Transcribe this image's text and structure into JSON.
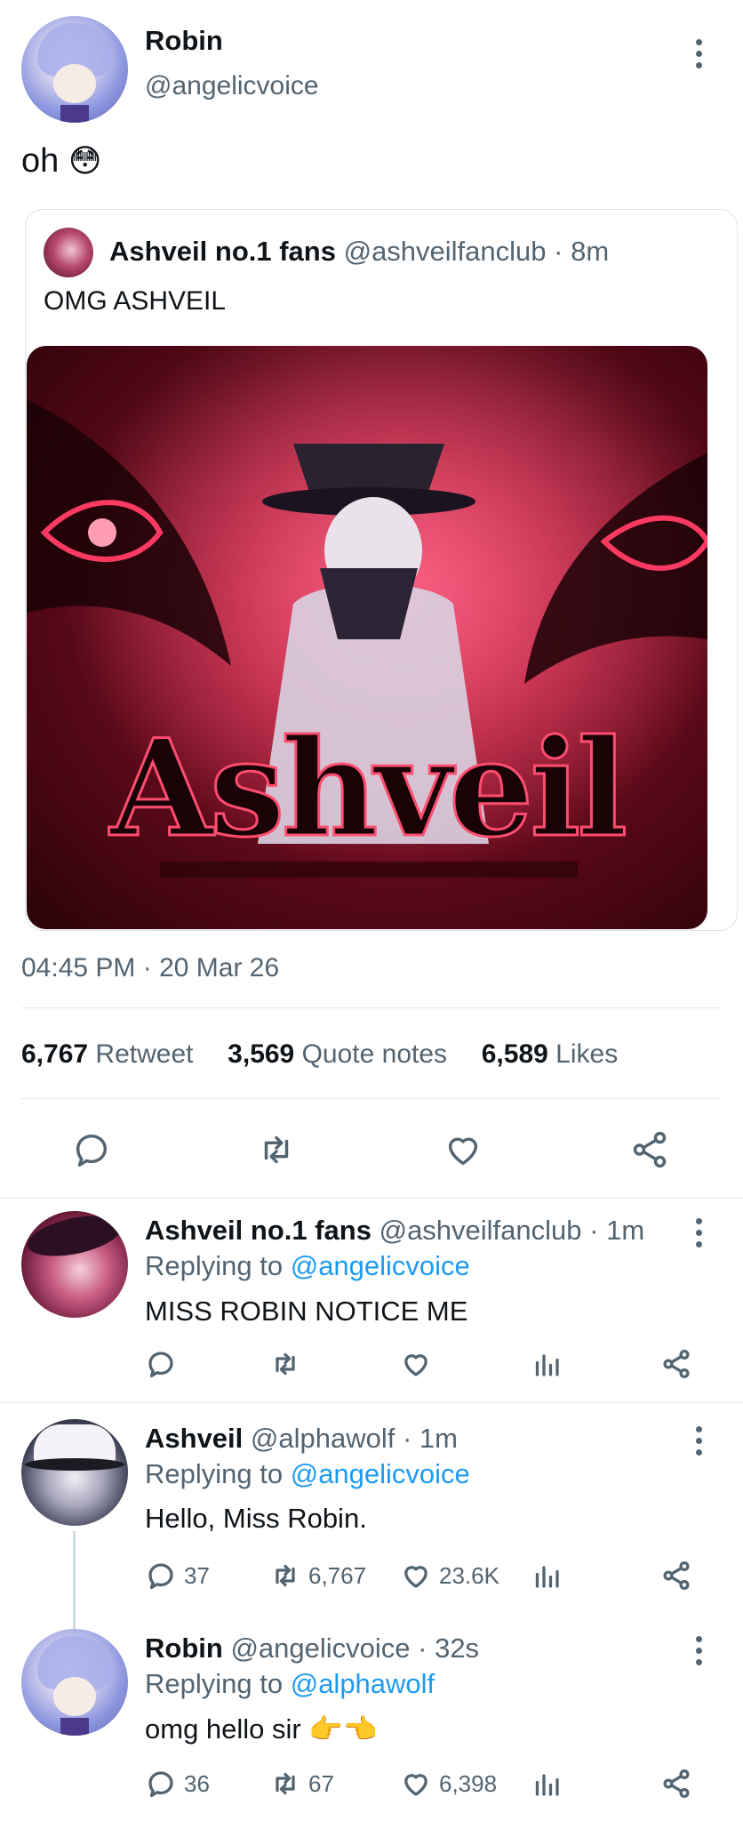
{
  "main_tweet": {
    "author_name": "Robin",
    "author_handle": "@angelicvoice",
    "text": "oh",
    "emoji": "😳",
    "quoted": {
      "author_name": "Ashveil no.1 fans",
      "author_handle": "@ashveilfanclub",
      "time": "· 8m",
      "text": "OMG ASHVEIL",
      "image_title": "Ashveil"
    },
    "timestamp": "04:45 PM · 20 Mar 26",
    "stats": {
      "retweets_count": "6,767",
      "retweets_label": "Retweet",
      "quotes_count": "3,569",
      "quotes_label": "Quote notes",
      "likes_count": "6,589",
      "likes_label": "Likes"
    }
  },
  "replies": [
    {
      "author_name": "Ashveil no.1 fans",
      "author_handle": "@ashveilfanclub",
      "time": "· 1m",
      "replying_prefix": "Replying to",
      "replying_to": "@angelicvoice",
      "text": "MISS ROBIN NOTICE ME",
      "reply_count": "",
      "retweet_count": "",
      "like_count": ""
    },
    {
      "author_name": "Ashveil",
      "author_handle": "@alphawolf",
      "time": "· 1m",
      "replying_prefix": "Replying to",
      "replying_to": "@angelicvoice",
      "text": "Hello, Miss Robin.",
      "reply_count": "37",
      "retweet_count": "6,767",
      "like_count": "23.6K"
    },
    {
      "author_name": "Robin",
      "author_handle": "@angelicvoice",
      "time": "· 32s",
      "replying_prefix": "Replying to",
      "replying_to": "@alphawolf",
      "text": "omg hello sir",
      "emoji": "👉👈",
      "reply_count": "36",
      "retweet_count": "67",
      "like_count": "6,398"
    }
  ],
  "colors": {
    "accent": "#1d9bf0",
    "muted": "#536471",
    "robin_avatar": "#8e98e0",
    "fanclub_avatar": "#7a1f3d",
    "ashveil_avatar": "#4b4f66",
    "image_bg": "#4a0712",
    "image_glow": "#d8234a"
  },
  "icons": [
    "more-vertical-icon",
    "reply-icon",
    "retweet-icon",
    "like-icon",
    "share-icon",
    "analytics-icon"
  ]
}
